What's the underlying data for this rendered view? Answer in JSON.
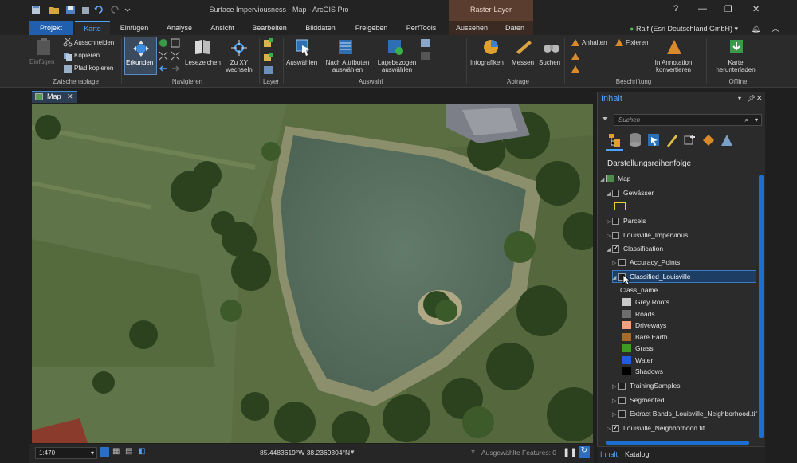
{
  "window": {
    "title": "Surface Imperviousness - Map - ArcGIS Pro",
    "contextual_tab_group": "Raster-Layer",
    "help": "?",
    "minimize": "—",
    "maximize": "❐",
    "close": "✕"
  },
  "tabs": [
    "Projekt",
    "Karte",
    "Einfügen",
    "Analyse",
    "Ansicht",
    "Bearbeiten",
    "Bilddaten",
    "Freigeben",
    "PerfTools",
    "Aussehen",
    "Daten"
  ],
  "active_tab": "Karte",
  "user": "Ralf (Esri Deutschland GmbH)",
  "ribbon": {
    "clipboard": {
      "paste": "Einfügen",
      "cut": "Ausschneiden",
      "copy": "Kopieren",
      "copy_path": "Pfad kopieren",
      "label": "Zwischenablage"
    },
    "navigate": {
      "explore": "Erkunden",
      "bookmarks": "Lesezeichen",
      "goto_xy_1": "Zu XY",
      "goto_xy_2": "wechseln",
      "label": "Navigieren"
    },
    "layer": {
      "label": "Layer"
    },
    "selection": {
      "select": "Auswählen",
      "by_attr_1": "Nach Attributen",
      "by_attr_2": "auswählen",
      "by_loc_1": "Lagebezogen",
      "by_loc_2": "auswählen",
      "label": "Auswahl"
    },
    "inquiry": {
      "infographics": "Infografiken",
      "measure": "Messen",
      "locate": "Suchen",
      "label": "Abfrage"
    },
    "labeling": {
      "pause": "Anhalten",
      "lock": "Fixieren",
      "convert_1": "In Annotation",
      "convert_2": "konvertieren",
      "label": "Beschriftung"
    },
    "offline": {
      "download_1": "Karte",
      "download_2": "herunterladen",
      "label": "Offline"
    }
  },
  "map_view": {
    "tab_label": "Map",
    "scale": "1:470",
    "coordinates": "85.4483619°W 38.2369304°N",
    "selected_features": "Ausgewählte Features: 0"
  },
  "contents": {
    "title": "Inhalt",
    "search_placeholder": "Suchen",
    "drawing_order": "Darstellungsreihenfolge",
    "layers": [
      {
        "name": "Map"
      },
      {
        "name": "Gewässer"
      },
      {
        "name": "Parcels"
      },
      {
        "name": "Louisville_Impervious"
      },
      {
        "name": "Classification"
      },
      {
        "name": "Accuracy_Points"
      },
      {
        "name": "Classified_Louisville"
      },
      {
        "name": "TrainingSamples"
      },
      {
        "name": "Segmented"
      },
      {
        "name": "Extract Bands_Louisville_Neighborhood.tif"
      },
      {
        "name": "Louisville_Neighborhood.tif"
      }
    ],
    "legend_field": "Class_name",
    "legend": [
      {
        "label": "Grey Roofs",
        "color": "#c8c8c8"
      },
      {
        "label": "Roads",
        "color": "#6e6e6e"
      },
      {
        "label": "Driveways",
        "color": "#f2a07f"
      },
      {
        "label": "Bare Earth",
        "color": "#a86a2a"
      },
      {
        "label": "Grass",
        "color": "#3f9a22"
      },
      {
        "label": "Water",
        "color": "#1f5de0"
      },
      {
        "label": "Shadows",
        "color": "#000000"
      }
    ],
    "bottom_tabs": [
      "Inhalt",
      "Katalog"
    ]
  }
}
